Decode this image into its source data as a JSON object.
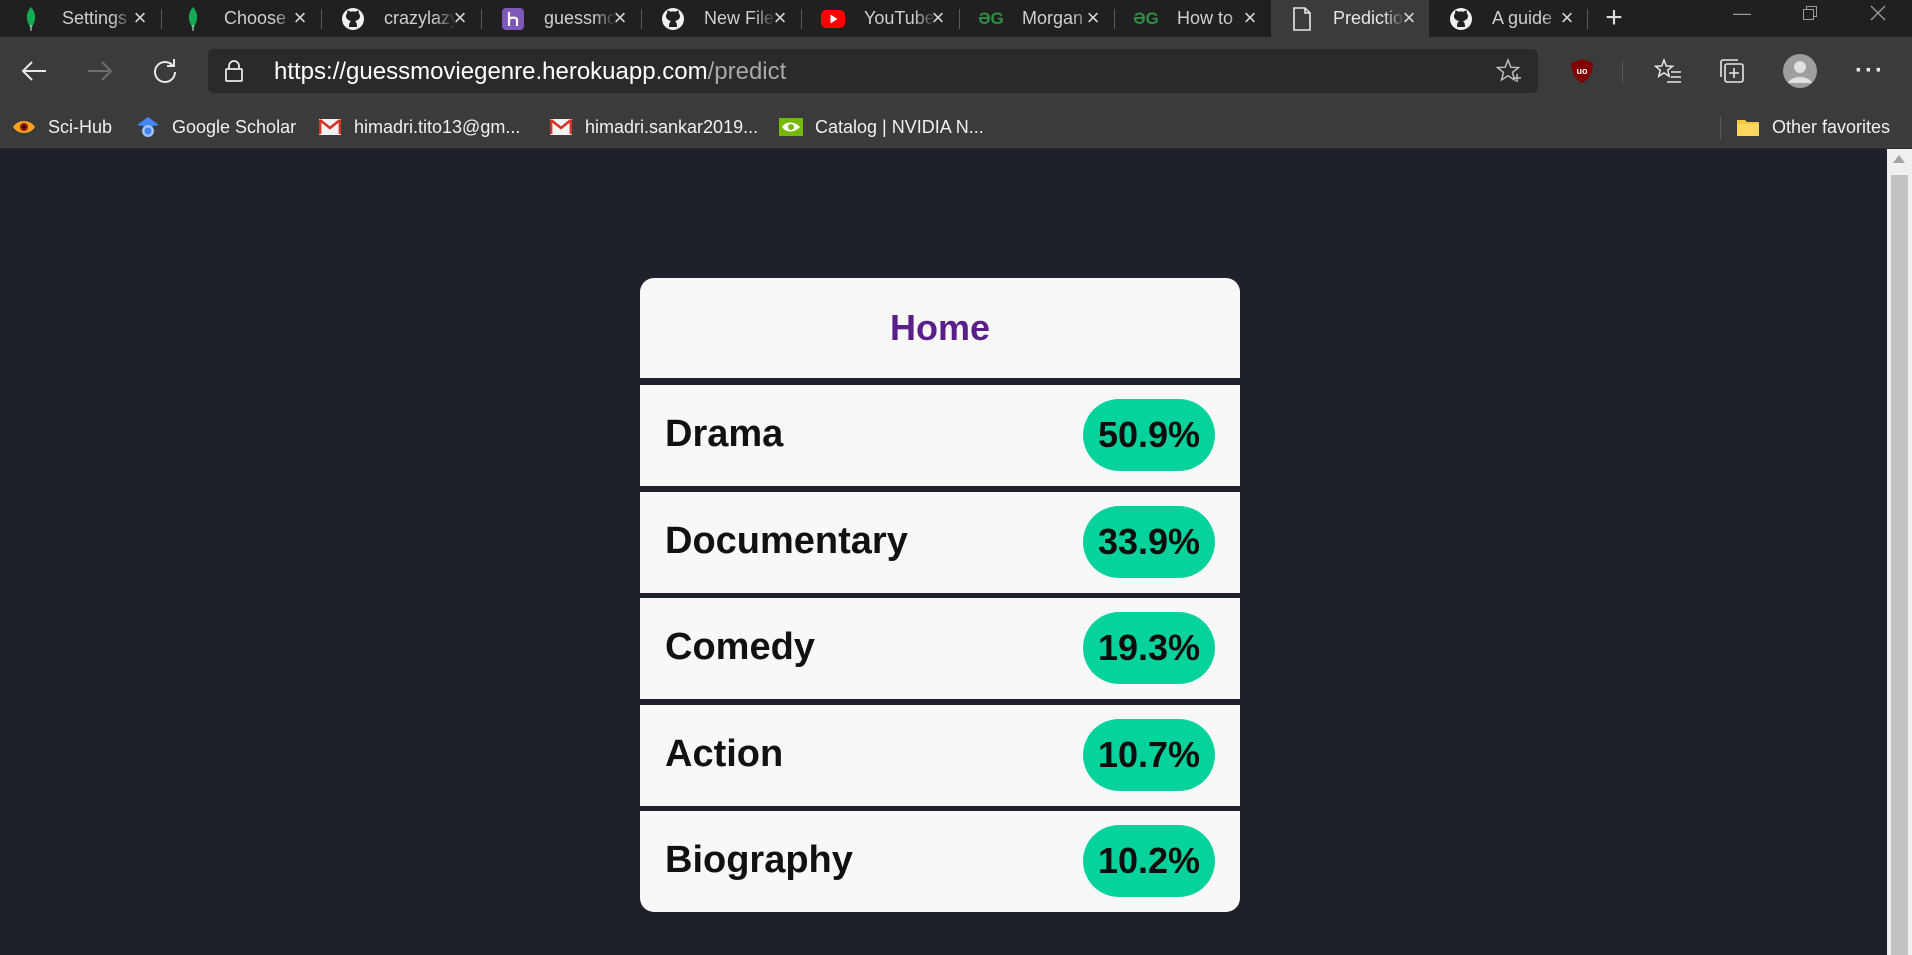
{
  "tabs": [
    {
      "title": "Settings",
      "icon": "mongodb-leaf-icon"
    },
    {
      "title": "Choose",
      "icon": "mongodb-leaf-icon"
    },
    {
      "title": "crazylazy",
      "icon": "github-icon"
    },
    {
      "title": "guessmovie",
      "icon": "heroku-icon"
    },
    {
      "title": "New File",
      "icon": "github-icon"
    },
    {
      "title": "YouTube",
      "icon": "youtube-icon"
    },
    {
      "title": "Morgan",
      "icon": "geeksforgeeks-icon"
    },
    {
      "title": "How to",
      "icon": "geeksforgeeks-icon"
    },
    {
      "title": "Prediction",
      "icon": "page-icon"
    },
    {
      "title": "A guide",
      "icon": "github-icon"
    }
  ],
  "address": {
    "host": "https://guessmoviegenre.herokuapp.com",
    "path": "/predict"
  },
  "favorites": [
    {
      "label": "Sci-Hub",
      "icon": "scihub-icon"
    },
    {
      "label": "Google Scholar",
      "icon": "google-scholar-icon"
    },
    {
      "label": "himadri.tito13@gm...",
      "icon": "gmail-icon"
    },
    {
      "label": "himadri.sankar2019...",
      "icon": "gmail-icon"
    },
    {
      "label": "Catalog | NVIDIA N...",
      "icon": "nvidia-icon"
    }
  ],
  "other_favorites": "Other favorites",
  "page": {
    "home_label": "Home",
    "predictions": [
      {
        "genre": "Drama",
        "percent": "50.9%"
      },
      {
        "genre": "Documentary",
        "percent": "33.9%"
      },
      {
        "genre": "Comedy",
        "percent": "19.3%"
      },
      {
        "genre": "Action",
        "percent": "10.7%"
      },
      {
        "genre": "Biography",
        "percent": "10.2%"
      }
    ]
  },
  "colors": {
    "page_bg": "#1e2129",
    "home_text": "#5b1f8c",
    "badge": "#06d39c"
  }
}
